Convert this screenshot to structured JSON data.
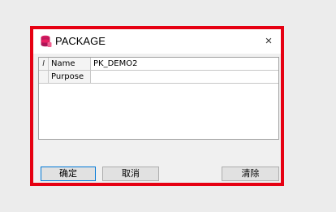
{
  "dialog": {
    "title": "PACKAGE",
    "close_symbol": "×",
    "icon": "database-stack-icon"
  },
  "grid": {
    "rows": [
      {
        "indicator": "I",
        "label": "Name",
        "value": "PK_DEMO2"
      },
      {
        "indicator": "",
        "label": "Purpose",
        "value": ""
      }
    ]
  },
  "buttons": {
    "ok": "确定",
    "cancel": "取消",
    "clear": "清除"
  },
  "colors": {
    "highlight_border": "#e60012",
    "icon_primary": "#c2185b"
  }
}
